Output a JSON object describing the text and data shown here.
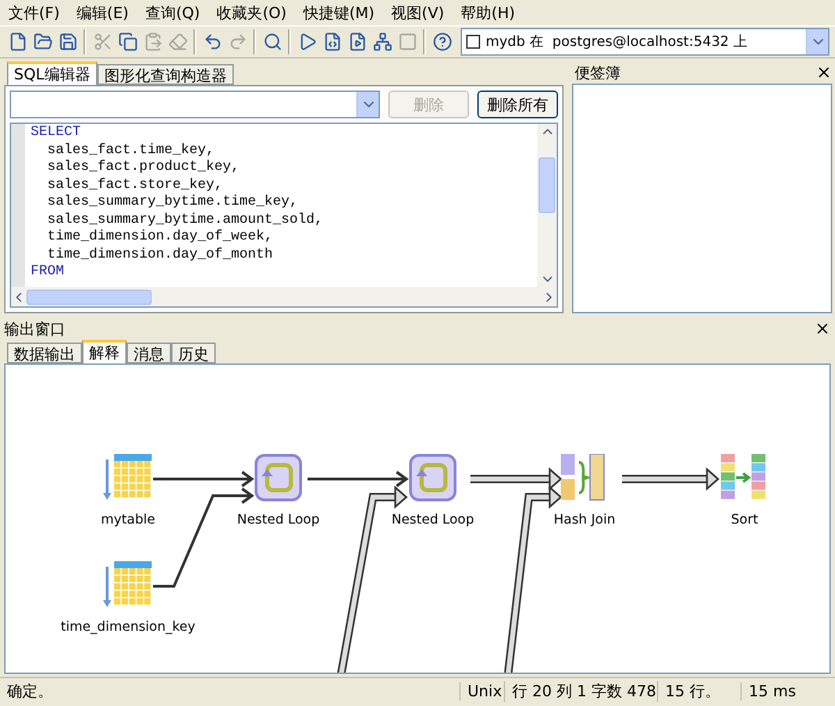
{
  "menu": [
    "文件(F)",
    "编辑(E)",
    "查询(Q)",
    "收藏夹(O)",
    "快捷键(M)",
    "视图(V)",
    "帮助(H)"
  ],
  "toolbar": [
    {
      "kind": "new",
      "disabled": false
    },
    {
      "kind": "open",
      "disabled": false
    },
    {
      "kind": "save",
      "disabled": false
    },
    {
      "kind": "sep"
    },
    {
      "kind": "cut",
      "disabled": true
    },
    {
      "kind": "copy",
      "disabled": false
    },
    {
      "kind": "paste",
      "disabled": true
    },
    {
      "kind": "clear",
      "disabled": true
    },
    {
      "kind": "sep"
    },
    {
      "kind": "undo",
      "disabled": false
    },
    {
      "kind": "redo",
      "disabled": true
    },
    {
      "kind": "sep"
    },
    {
      "kind": "find",
      "disabled": false
    },
    {
      "kind": "sep"
    },
    {
      "kind": "run",
      "disabled": false
    },
    {
      "kind": "run_script",
      "disabled": false
    },
    {
      "kind": "run_file",
      "disabled": false
    },
    {
      "kind": "explain",
      "disabled": false
    },
    {
      "kind": "stop",
      "disabled": true
    },
    {
      "kind": "sep"
    },
    {
      "kind": "help",
      "disabled": false
    }
  ],
  "connection": {
    "label": "mydb 在  postgres@localhost:5432 上",
    "checked": false
  },
  "editor_tabs": [
    {
      "label": "SQL编辑器",
      "selected": true
    },
    {
      "label": "图形化查询构造器",
      "selected": false
    }
  ],
  "history_buttons": [
    {
      "label": "删除",
      "disabled": true
    },
    {
      "label": "删除所有",
      "disabled": false
    }
  ],
  "sql_lines": [
    {
      "text": "SELECT",
      "kind": "keyword"
    },
    {
      "text": "  sales_fact.time_key,",
      "kind": "plain"
    },
    {
      "text": "  sales_fact.product_key,",
      "kind": "plain"
    },
    {
      "text": "  sales_fact.store_key,",
      "kind": "plain"
    },
    {
      "text": "  sales_summary_bytime.time_key,",
      "kind": "plain"
    },
    {
      "text": "  sales_summary_bytime.amount_sold,",
      "kind": "plain"
    },
    {
      "text": "  time_dimension.day_of_week,",
      "kind": "plain"
    },
    {
      "text": "  time_dimension.day_of_month",
      "kind": "plain"
    },
    {
      "text": "FROM",
      "kind": "keyword"
    }
  ],
  "scratch_pad": {
    "title": "便签簿"
  },
  "output": {
    "title": "输出窗口",
    "tabs": [
      {
        "label": "数据输出",
        "selected": false
      },
      {
        "label": "解释",
        "selected": true
      },
      {
        "label": "消息",
        "selected": false
      },
      {
        "label": "历史",
        "selected": false
      }
    ],
    "plan_nodes": [
      {
        "label": "mytable",
        "kind": "table"
      },
      {
        "label": "time_dimension_key",
        "kind": "table"
      },
      {
        "label": "Nested Loop",
        "kind": "nested_loop"
      },
      {
        "label": "Nested Loop",
        "kind": "nested_loop"
      },
      {
        "label": "Hash Join",
        "kind": "hash_join"
      },
      {
        "label": "Sort",
        "kind": "sort"
      }
    ]
  },
  "status_bar": [
    "确定。",
    "Unix",
    "行 20 列 1 字数 478",
    "15 行。",
    "15 ms"
  ]
}
